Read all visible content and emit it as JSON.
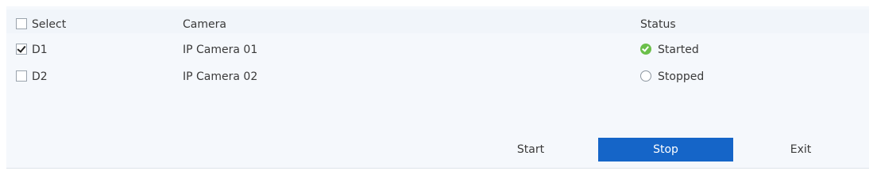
{
  "table": {
    "headers": {
      "select": "Select",
      "camera": "Camera",
      "status": "Status"
    },
    "rows": [
      {
        "id": "D1",
        "selected": true,
        "camera": "IP Camera 01",
        "status": "Started",
        "status_icon": "started-check-icon"
      },
      {
        "id": "D2",
        "selected": false,
        "camera": "IP Camera 02",
        "status": "Stopped",
        "status_icon": "stopped-circle-icon"
      }
    ]
  },
  "buttons": {
    "start": "Start",
    "stop": "Stop",
    "exit": "Exit"
  },
  "colors": {
    "accent": "#1565c8",
    "started": "#6bbf4a"
  }
}
